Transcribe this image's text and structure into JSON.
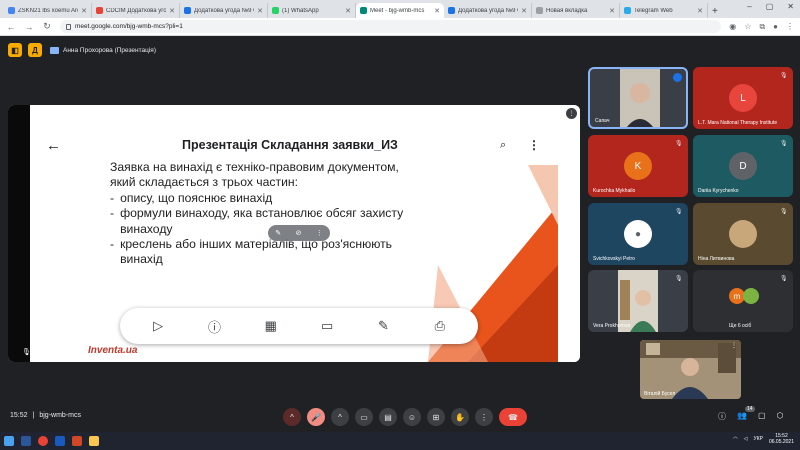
{
  "browser": {
    "tabs": [
      {
        "label": "ZSKN21 lbs xoemu Arc",
        "color": "#4285f4"
      },
      {
        "label": "CDCIM Додаткова угода",
        "color": "#ea4335"
      },
      {
        "label": "Додаткова угода №9 CC",
        "color": "#1a73e8"
      },
      {
        "label": "(1) WhatsApp",
        "color": "#25d366"
      },
      {
        "label": "Meet - bjg-wmb-mcs",
        "color": "#00897b",
        "active": true
      },
      {
        "label": "Додаткова угода №9 CC",
        "color": "#1a73e8"
      },
      {
        "label": "Новая вкладка",
        "color": "#9aa0a6"
      },
      {
        "label": "Telegram Web",
        "color": "#2aabee"
      }
    ],
    "url": "meet.google.com/bjg-wmb-mcs?pli=1",
    "new_tab": "+"
  },
  "meet": {
    "presenting_title": "Анна Прохорова (Презентація)",
    "top_buttons": [
      "◧",
      "Д"
    ],
    "meeting_code": "bjg-wmb-mcs",
    "time": "15:52",
    "self_badge": "14"
  },
  "slide": {
    "title": "Презентація Складання заявки_ИЗ",
    "intro": "Заявка на винахід є техніко-правовим документом, який складається з трьох частин:",
    "bullets": [
      "опису, що пояснює винахід",
      "формули винаходу, яка встановлює обсяг захисту винаходу",
      "креслень або інших матеріалів, що роз'яснюють винахід"
    ],
    "bullet_marker": "-",
    "footer_brand": "Inventa.ua",
    "presenter_label": "Анна Прохорова"
  },
  "participants": [
    {
      "name": "Сапач",
      "bg": "#3a3f47",
      "initial": "",
      "video": true
    },
    {
      "name": "L.T. Mara National Therapy Institute",
      "bg": "#b3261e",
      "initial": "L",
      "avatar_bg": "#e8453c"
    },
    {
      "name": "Kurochka Mykhailo",
      "bg": "#b3261e",
      "initial": "K",
      "avatar_bg": "#e8711a"
    },
    {
      "name": "Dariia Kyrychenko",
      "bg": "#1e5a61",
      "initial": "D",
      "avatar_bg": "#5f6368"
    },
    {
      "name": "Svichkovskyi Petro",
      "bg": "#1e4661",
      "initial": "",
      "avatar_bg": "#ffffff"
    },
    {
      "name": "Ніна Литвинова",
      "bg": "#5a4a2f",
      "initial": "",
      "avatar_bg": "#c8a77a"
    },
    {
      "name": "Vera Prokhorova",
      "bg": "#3a3f47",
      "initial": "",
      "video": true
    },
    {
      "name": "Ще 6 осіб",
      "bg": "#2d2f33",
      "initial": "m",
      "avatar_bg": "#e8711a"
    }
  ],
  "self_name": "Віталій Бусел",
  "taskbar": {
    "time": "15:52",
    "date": "06.05.2021",
    "lang": "УКР"
  },
  "colors": {
    "accent_yellow": "#f9ab00",
    "end_call_red": "#ea4335",
    "slide_orange": "#e8541c"
  }
}
